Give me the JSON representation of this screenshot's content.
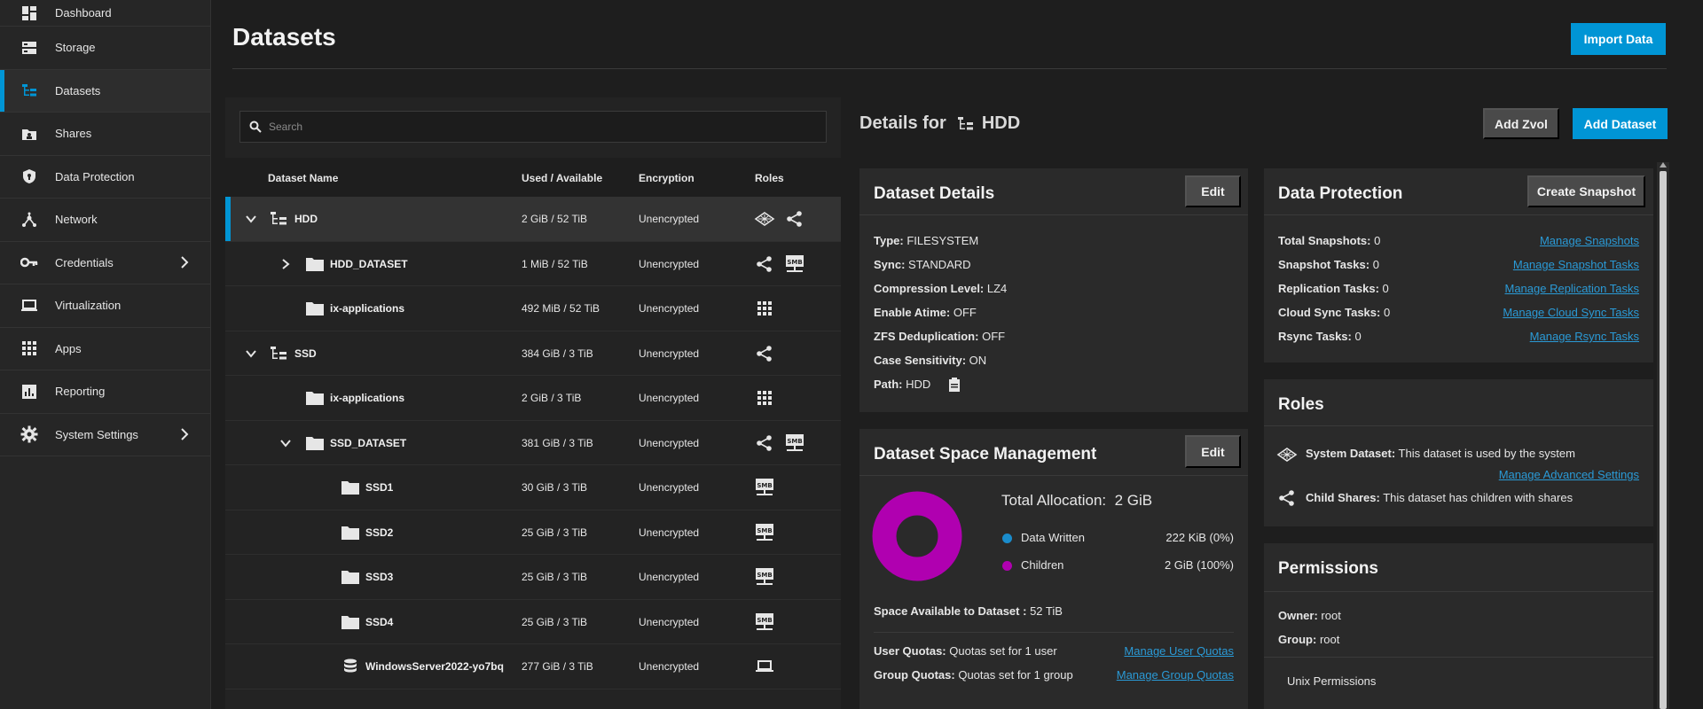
{
  "sidebar": {
    "items": [
      {
        "label": "Dashboard",
        "icon": "dashboard-icon"
      },
      {
        "label": "Storage",
        "icon": "storage-icon"
      },
      {
        "label": "Datasets",
        "icon": "datasets-icon"
      },
      {
        "label": "Shares",
        "icon": "shares-icon"
      },
      {
        "label": "Data Protection",
        "icon": "shield-icon"
      },
      {
        "label": "Network",
        "icon": "network-icon"
      },
      {
        "label": "Credentials",
        "icon": "key-icon"
      },
      {
        "label": "Virtualization",
        "icon": "laptop-icon"
      },
      {
        "label": "Apps",
        "icon": "apps-grid-icon"
      },
      {
        "label": "Reporting",
        "icon": "reporting-icon"
      },
      {
        "label": "System Settings",
        "icon": "gear-icon"
      }
    ]
  },
  "header": {
    "title": "Datasets",
    "import_label": "Import Data"
  },
  "search": {
    "placeholder": "Search"
  },
  "table": {
    "columns": [
      "Dataset Name",
      "Used / Available",
      "Encryption",
      "Roles"
    ],
    "rows": [
      {
        "name": "HDD",
        "used": "2 GiB / 52 TiB",
        "enc": "Unencrypted"
      },
      {
        "name": "HDD_DATASET",
        "used": "1 MiB / 52 TiB",
        "enc": "Unencrypted"
      },
      {
        "name": "ix-applications",
        "used": "492 MiB / 52 TiB",
        "enc": "Unencrypted"
      },
      {
        "name": "SSD",
        "used": "384 GiB / 3 TiB",
        "enc": "Unencrypted"
      },
      {
        "name": "ix-applications",
        "used": "2 GiB / 3 TiB",
        "enc": "Unencrypted"
      },
      {
        "name": "SSD_DATASET",
        "used": "381 GiB / 3 TiB",
        "enc": "Unencrypted"
      },
      {
        "name": "SSD1",
        "used": "30 GiB / 3 TiB",
        "enc": "Unencrypted"
      },
      {
        "name": "SSD2",
        "used": "25 GiB / 3 TiB",
        "enc": "Unencrypted"
      },
      {
        "name": "SSD3",
        "used": "25 GiB / 3 TiB",
        "enc": "Unencrypted"
      },
      {
        "name": "SSD4",
        "used": "25 GiB / 3 TiB",
        "enc": "Unencrypted"
      },
      {
        "name": "WindowsServer2022-yo7bq",
        "used": "277 GiB / 3 TiB",
        "enc": "Unencrypted"
      }
    ]
  },
  "details": {
    "title_prefix": "Details for",
    "selected": "HDD",
    "add_zvol_label": "Add Zvol",
    "add_dataset_label": "Add Dataset"
  },
  "dataset_details": {
    "title": "Dataset Details",
    "edit_label": "Edit",
    "fields": [
      {
        "k": "Type:",
        "v": "FILESYSTEM"
      },
      {
        "k": "Sync:",
        "v": "STANDARD"
      },
      {
        "k": "Compression Level:",
        "v": "LZ4"
      },
      {
        "k": "Enable Atime:",
        "v": "OFF"
      },
      {
        "k": "ZFS Deduplication:",
        "v": "OFF"
      },
      {
        "k": "Case Sensitivity:",
        "v": "ON"
      },
      {
        "k": "Path:",
        "v": "HDD"
      }
    ]
  },
  "space": {
    "title": "Dataset Space Management",
    "edit_label": "Edit",
    "total_label": "Total Allocation:",
    "total_value": "2 GiB",
    "legend": [
      {
        "label": "Data Written",
        "value": "222 KiB (0%)",
        "color": "#1a8ccc",
        "fraction": 0.0
      },
      {
        "label": "Children",
        "value": "2 GiB (100%)",
        "color": "#b000b0",
        "fraction": 1.0
      }
    ],
    "available_label": "Space Available to Dataset :",
    "available_value": "52 TiB",
    "user_quotas_label": "User Quotas:",
    "user_quotas_value": "Quotas set for 1 user",
    "user_quotas_link": "Manage User Quotas",
    "group_quotas_label": "Group Quotas:",
    "group_quotas_value": "Quotas set for 1 group",
    "group_quotas_link": "Manage Group Quotas"
  },
  "protection": {
    "title": "Data Protection",
    "create_label": "Create Snapshot",
    "items": [
      {
        "k": "Total Snapshots:",
        "v": "0",
        "link": "Manage Snapshots"
      },
      {
        "k": "Snapshot Tasks:",
        "v": "0",
        "link": "Manage Snapshot Tasks"
      },
      {
        "k": "Replication Tasks:",
        "v": "0",
        "link": "Manage Replication Tasks"
      },
      {
        "k": "Cloud Sync Tasks:",
        "v": "0",
        "link": "Manage Cloud Sync Tasks"
      },
      {
        "k": "Rsync Tasks:",
        "v": "0",
        "link": "Manage Rsync Tasks"
      }
    ]
  },
  "roles": {
    "title": "Roles",
    "system_label": "System Dataset:",
    "system_text": "This dataset is used by the system",
    "advanced_link": "Manage Advanced Settings",
    "child_label": "Child Shares:",
    "child_text": "This dataset has children with shares"
  },
  "permissions": {
    "title": "Permissions",
    "owner_label": "Owner:",
    "owner_value": "root",
    "group_label": "Group:",
    "group_value": "root",
    "unix_label": "Unix Permissions"
  }
}
